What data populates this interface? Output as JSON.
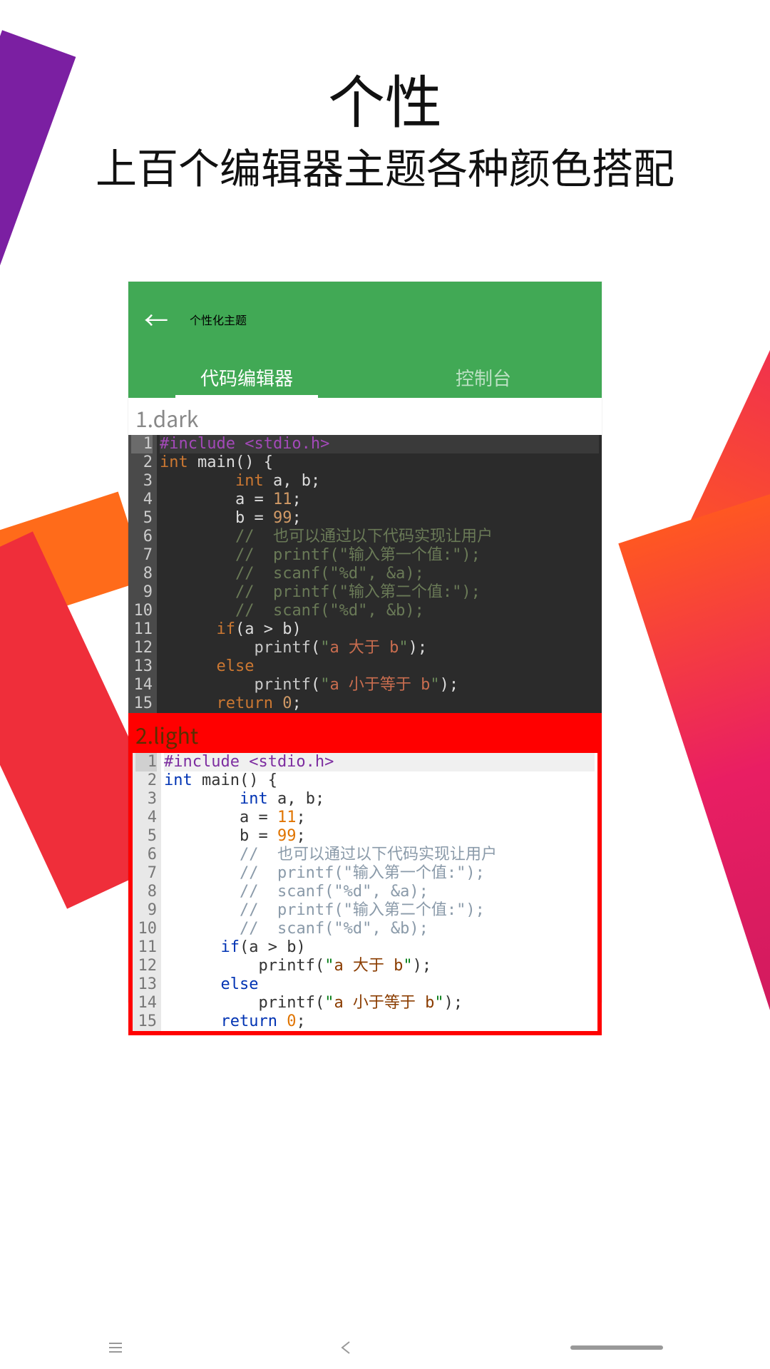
{
  "promo": {
    "title": "个性",
    "subtitle": "上百个编辑器主题各种颜色搭配"
  },
  "appbar": {
    "title": "个性化主题"
  },
  "tabs": {
    "editor": "代码编辑器",
    "console": "控制台"
  },
  "themes": {
    "dark_label": "1.dark",
    "light_label": "2.light"
  },
  "code": {
    "lines": [
      {
        "n": "1",
        "hl": true,
        "src": [
          [
            "pre",
            "#include <stdio.h>"
          ]
        ]
      },
      {
        "n": "2",
        "src": [
          [
            "kw",
            "int"
          ],
          [
            "",
            " main() {"
          ]
        ]
      },
      {
        "n": "3",
        "src": [
          [
            "",
            "        "
          ],
          [
            "kw",
            "int"
          ],
          [
            "",
            " a, b;"
          ]
        ]
      },
      {
        "n": "4",
        "src": [
          [
            "",
            "        a = "
          ],
          [
            "num",
            "11"
          ],
          [
            "",
            ";"
          ]
        ]
      },
      {
        "n": "5",
        "src": [
          [
            "",
            "        b = "
          ],
          [
            "num",
            "99"
          ],
          [
            "",
            ";"
          ]
        ]
      },
      {
        "n": "6",
        "src": [
          [
            "",
            "        "
          ],
          [
            "cm",
            "//  也可以通过以下代码实现让用户"
          ]
        ]
      },
      {
        "n": "7",
        "src": [
          [
            "",
            "        "
          ],
          [
            "cm",
            "//  printf(\"输入第一个值:\");"
          ]
        ]
      },
      {
        "n": "8",
        "src": [
          [
            "",
            "        "
          ],
          [
            "cm",
            "//  scanf(\"%d\", &a);"
          ]
        ]
      },
      {
        "n": "9",
        "src": [
          [
            "",
            "        "
          ],
          [
            "cm",
            "//  printf(\"输入第二个值:\");"
          ]
        ]
      },
      {
        "n": "10",
        "src": [
          [
            "",
            "        "
          ],
          [
            "cm",
            "//  scanf(\"%d\", &b);"
          ]
        ]
      },
      {
        "n": "11",
        "src": [
          [
            "",
            "      "
          ],
          [
            "kw",
            "if"
          ],
          [
            "",
            "(a > b)"
          ]
        ]
      },
      {
        "n": "12",
        "src": [
          [
            "",
            "          "
          ],
          [
            "fn",
            "printf"
          ],
          [
            "",
            "("
          ],
          [
            "str",
            "\""
          ],
          [
            "strhl",
            "a 大于 b"
          ],
          [
            "str",
            "\""
          ],
          [
            "",
            ");"
          ]
        ]
      },
      {
        "n": "13",
        "src": [
          [
            "",
            "      "
          ],
          [
            "kw",
            "else"
          ]
        ]
      },
      {
        "n": "14",
        "src": [
          [
            "",
            "          "
          ],
          [
            "fn",
            "printf"
          ],
          [
            "",
            "("
          ],
          [
            "str",
            "\""
          ],
          [
            "strhl",
            "a 小于等于 b"
          ],
          [
            "str",
            "\""
          ],
          [
            "",
            ");"
          ]
        ]
      },
      {
        "n": "15",
        "src": [
          [
            "",
            "      "
          ],
          [
            "kw",
            "return"
          ],
          [
            "",
            " "
          ],
          [
            "num",
            "0"
          ],
          [
            "",
            ";"
          ]
        ]
      }
    ]
  }
}
